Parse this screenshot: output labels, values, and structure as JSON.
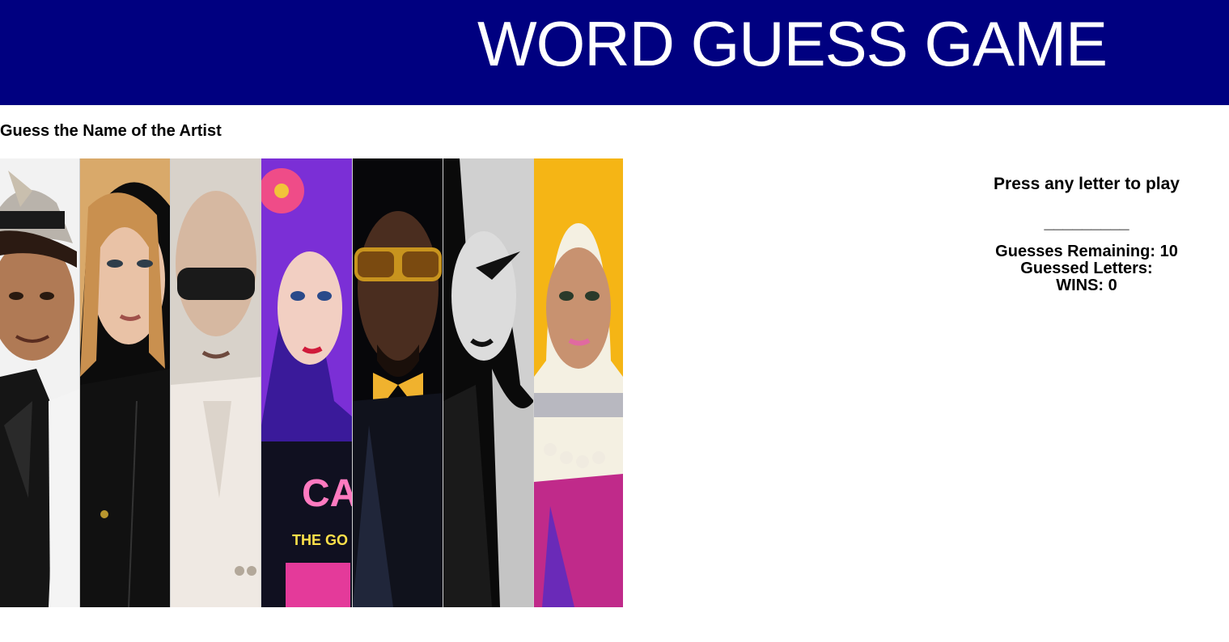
{
  "header": {
    "title": "WORD GUESS GAME"
  },
  "main": {
    "subtitle": "Guess the Name of the Artist",
    "collage": {
      "strips": [
        {
          "name": "artist-strip-1",
          "accent": "#1d1d1d"
        },
        {
          "name": "artist-strip-2",
          "accent": "#0d0d0d"
        },
        {
          "name": "artist-strip-3",
          "accent": "#e8e2da"
        },
        {
          "name": "artist-strip-4",
          "accent": "#7b2fd6"
        },
        {
          "name": "artist-strip-5",
          "accent": "#0a0a12"
        },
        {
          "name": "artist-strip-6",
          "accent": "#bdbdbd"
        },
        {
          "name": "artist-strip-7",
          "accent": "#f5b515"
        }
      ],
      "shirt_text_1": "CA",
      "shirt_text_2": "THE GO"
    }
  },
  "panel": {
    "prompt": "Press any letter to play",
    "blanks": "_________",
    "guesses_remaining": "Guesses Remaining: 10",
    "guessed_letters": "Guessed Letters:",
    "wins": "WINS: 0"
  },
  "colors": {
    "header_bg": "#000080",
    "header_text": "#ffffff",
    "body_bg": "#ffffff"
  }
}
